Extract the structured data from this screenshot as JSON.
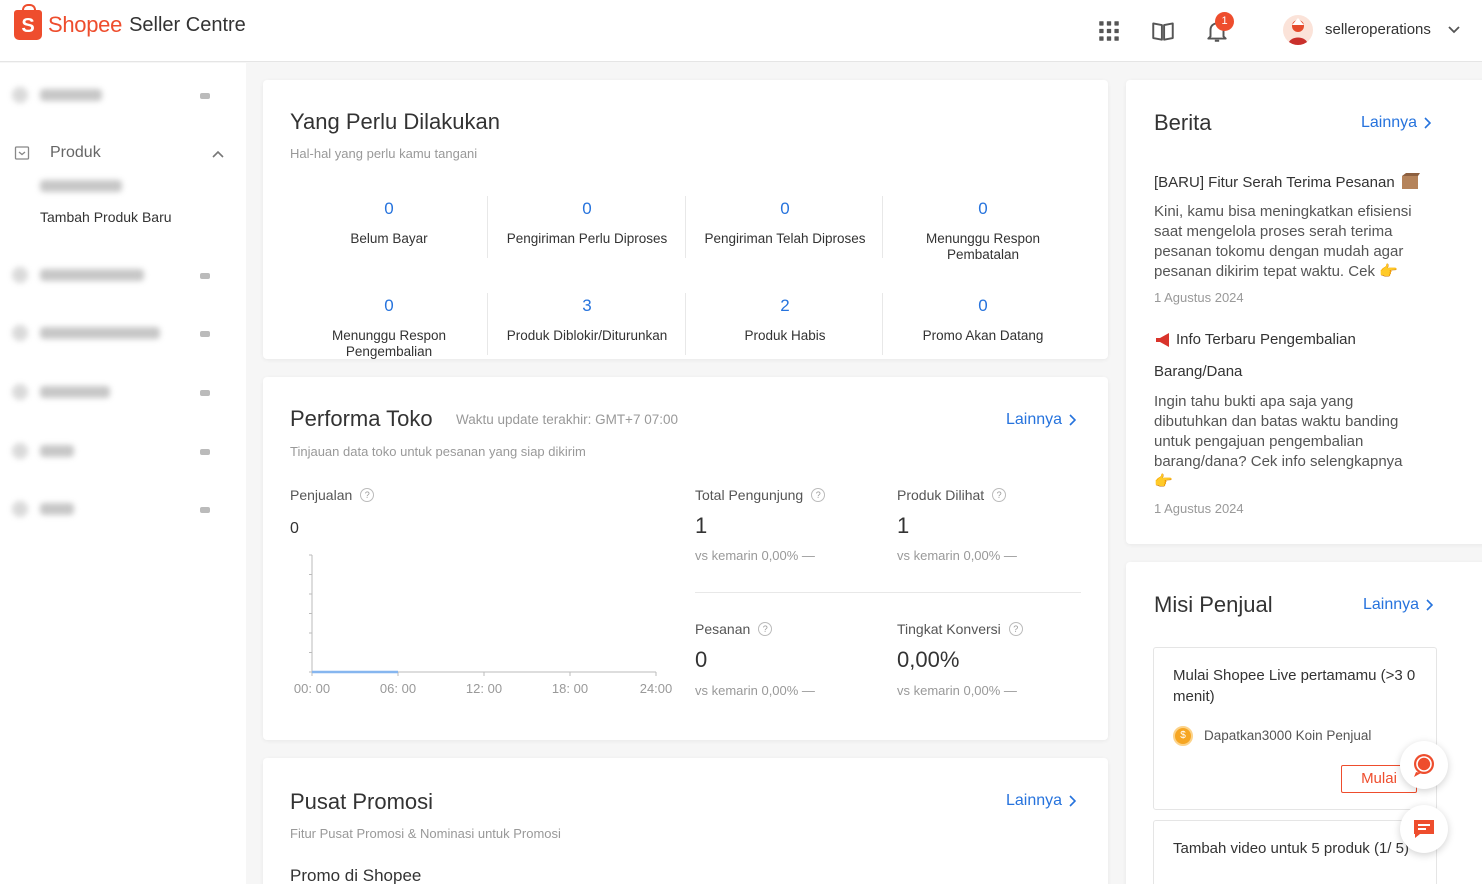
{
  "header": {
    "brand": "Shopee",
    "product": "Seller Centre",
    "notification_count": "1",
    "username": "selleroperations"
  },
  "sidebar": {
    "produk_label": "Produk",
    "sub_items": [
      "Tambah Produk Baru"
    ]
  },
  "todo": {
    "title": "Yang Perlu Dilakukan",
    "subtitle": "Hal-hal yang perlu kamu tangani",
    "items": [
      {
        "value": "0",
        "label": "Belum Bayar"
      },
      {
        "value": "0",
        "label": "Pengiriman Perlu Diproses"
      },
      {
        "value": "0",
        "label": "Pengiriman Telah Diproses"
      },
      {
        "value": "0",
        "label": "Menunggu Respon Pembatalan"
      },
      {
        "value": "0",
        "label": "Menunggu Respon Pengembalian"
      },
      {
        "value": "3",
        "label": "Produk Diblokir/Diturunkan"
      },
      {
        "value": "2",
        "label": "Produk Habis"
      },
      {
        "value": "0",
        "label": "Promo Akan Datang"
      }
    ]
  },
  "performa": {
    "title": "Performa Toko",
    "update_text": "Waktu update terakhir: GMT+7 07:00",
    "more_label": "Lainnya",
    "subtitle": "Tinjauan data toko untuk pesanan yang siap dikirim",
    "sales_label": "Penjualan",
    "sales_value": "0",
    "metrics": [
      {
        "label": "Total Pengunjung",
        "value": "1",
        "vs": "vs kemarin 0,00% —"
      },
      {
        "label": "Produk Dilihat",
        "value": "1",
        "vs": "vs kemarin 0,00% —"
      },
      {
        "label": "Pesanan",
        "value": "0",
        "vs": "vs kemarin 0,00% —"
      },
      {
        "label": "Tingkat Konversi",
        "value": "0,00%",
        "vs": "vs kemarin 0,00% —"
      }
    ]
  },
  "chart_data": {
    "type": "line",
    "title": "",
    "xlabel": "",
    "ylabel": "",
    "x": [
      "00: 00",
      "06: 00",
      "12: 00",
      "18: 00",
      "24:00"
    ],
    "series": [
      {
        "values": [
          0,
          0
        ]
      }
    ],
    "grid": false
  },
  "promosi": {
    "title": "Pusat Promosi",
    "more_label": "Lainnya",
    "subtitle": "Fitur Pusat Promosi & Nominasi untuk Promosi",
    "section_title": "Promo di Shopee"
  },
  "berita": {
    "title": "Berita",
    "more_label": "Lainnya",
    "items": [
      {
        "title": "[BARU] Fitur Serah Terima Pesanan",
        "body": "Kini, kamu bisa meningkatkan efisiensi saat mengelola proses serah terima pesanan tokomu dengan mudah agar pesanan dikirim tepat waktu. Cek",
        "date": "1 Agustus 2024"
      },
      {
        "title_line1": "Info Terbaru Pengembalian",
        "title_line2": "Barang/Dana",
        "body": "Ingin tahu bukti apa saja yang dibutuhkan dan batas waktu banding untuk pengajuan pengembalian barang/dana? Cek info selengkapnya",
        "date": "1 Agustus 2024"
      }
    ]
  },
  "misi": {
    "title": "Misi Penjual",
    "more_label": "Lainnya",
    "missions": [
      {
        "title": "Mulai Shopee Live pertamamu (>3 0 menit)",
        "reward": "Dapatkan3000 Koin Penjual",
        "button": "Mulai"
      },
      {
        "title": "Tambah video untuk 5 produk (1/ 5)"
      }
    ]
  },
  "colors": {
    "brand": "#ee4d2d",
    "link": "#2673dd"
  }
}
